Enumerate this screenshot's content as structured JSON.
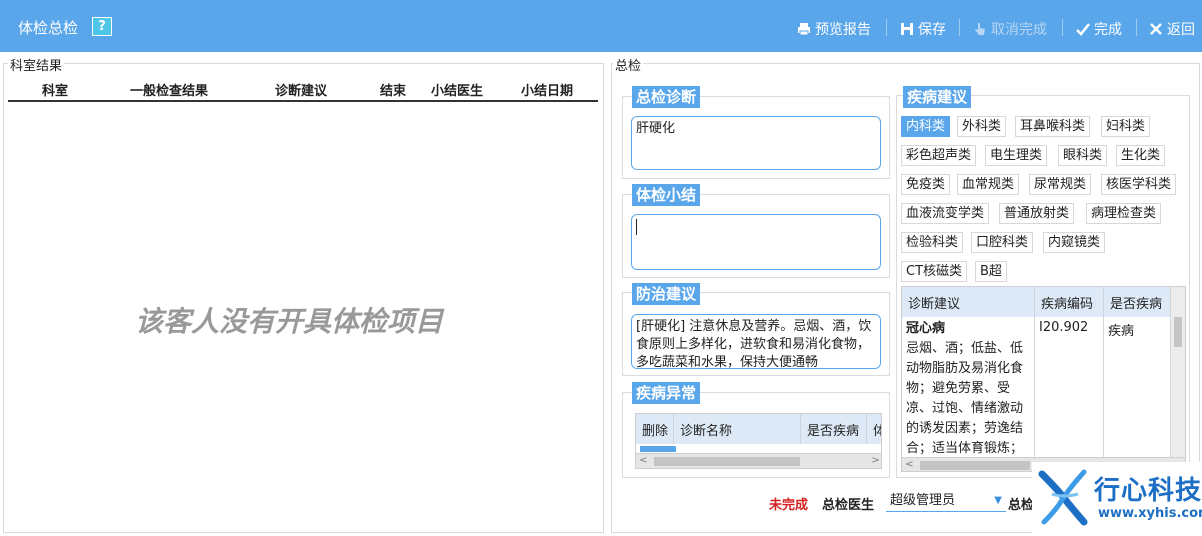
{
  "window": {
    "title": "体检总检",
    "help_label": "?"
  },
  "toolbar": {
    "preview_label": "预览报告",
    "save_label": "保存",
    "cancel_complete_label": "取消完成",
    "complete_label": "完成",
    "back_label": "返回"
  },
  "left": {
    "group_title": "科室结果",
    "columns": [
      "科室",
      "一般检查结果",
      "诊断建议",
      "结束",
      "小结医生",
      "小结日期"
    ],
    "empty_message": "该客人没有开具体检项目"
  },
  "right": {
    "group_title": "总检",
    "diagnosis": {
      "label": "总检诊断",
      "value": "肝硬化"
    },
    "summary": {
      "label": "体检小结",
      "value": ""
    },
    "advice": {
      "label": "防治建议",
      "value": "[肝硬化] 注意休息及营养。忌烟、酒，饮食原则上多样化，进软食和易消化食物，多吃蔬菜和水果，保持大便通畅"
    },
    "abnormal": {
      "label": "疾病异常",
      "columns": [
        "删除",
        "诊断名称",
        "是否疾病",
        "体"
      ]
    },
    "disease_advice": {
      "label": "疾病建议",
      "categories": [
        "内科类",
        "外科类",
        "耳鼻喉科类",
        "妇科类",
        "彩色超声类",
        "电生理类",
        "眼科类",
        "生化类",
        "免疫类",
        "血常规类",
        "尿常规类",
        "核医学科类",
        "血液流变学类",
        "普通放射类",
        "病理检查类",
        "检验科类",
        "口腔科类",
        "内窥镜类",
        "CT核磁类",
        "B超"
      ],
      "active_category": "内科类",
      "columns": [
        "诊断建议",
        "疾病编码",
        "是否疾病"
      ],
      "rows": [
        {
          "name": "冠心病",
          "advice": "忌烟、酒；低盐、低动物脂肪及易消化食物；避免劳累、受凉、过饱、情绪激动的诱发因素；劳逸结合；适当体育锻炼；",
          "code": "I20.902",
          "is_disease": "疾病"
        }
      ]
    }
  },
  "footer": {
    "status": "未完成",
    "doctor_label": "总检医生",
    "doctor_value": "超级管理员",
    "date_label": "总检"
  },
  "brand": {
    "name": "行心科技",
    "url": "www.xyhis.com"
  },
  "colors": {
    "primary": "#5aa6ea",
    "status_incomplete": "#d42020"
  }
}
